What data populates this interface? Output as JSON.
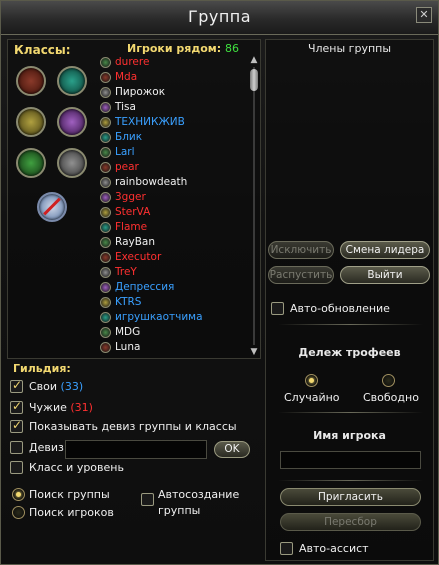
{
  "window": {
    "title": "Группа",
    "close_glyph": "✕"
  },
  "left": {
    "classes_label": "Классы:",
    "players_label": "Игроки рядом:",
    "players_count": "86",
    "class_icons": [
      "class-icon-1",
      "class-icon-2",
      "class-icon-3",
      "class-icon-4",
      "class-icon-5",
      "class-icon-6",
      "class-none-icon"
    ],
    "players": [
      {
        "name": "durere",
        "color": "red"
      },
      {
        "name": "Mda",
        "color": "red"
      },
      {
        "name": "Пирожок",
        "color": "white"
      },
      {
        "name": "Tisa",
        "color": "white"
      },
      {
        "name": "ТЕХНИКЖИВ",
        "color": "blue"
      },
      {
        "name": "Блик",
        "color": "blue"
      },
      {
        "name": "Larl",
        "color": "blue"
      },
      {
        "name": "pear",
        "color": "red"
      },
      {
        "name": "rainbowdeath",
        "color": "white"
      },
      {
        "name": "3gger",
        "color": "red"
      },
      {
        "name": "SterVA",
        "color": "red"
      },
      {
        "name": "Flame",
        "color": "red"
      },
      {
        "name": "RayBan",
        "color": "white"
      },
      {
        "name": "Executor",
        "color": "red"
      },
      {
        "name": "TreY",
        "color": "red"
      },
      {
        "name": "Депрессия",
        "color": "blue"
      },
      {
        "name": "KTRS",
        "color": "blue"
      },
      {
        "name": "игрушкаотчима",
        "color": "blue"
      },
      {
        "name": "MDG",
        "color": "white"
      },
      {
        "name": "Luna",
        "color": "white"
      }
    ]
  },
  "guild": {
    "label": "Гильдия:",
    "own_label": "Свои",
    "own_count": "(33)",
    "foreign_label": "Чужие",
    "foreign_count": "(31)",
    "show_motto_label": "Показывать девиз группы и классы",
    "motto_label": "Девиз",
    "motto_value": "",
    "ok_label": "OK",
    "class_level_label": "Класс и уровень",
    "search_group_label": "Поиск группы",
    "search_players_label": "Поиск игроков",
    "autocreate_label_line1": "Автосоздание",
    "autocreate_label_line2": "группы"
  },
  "right": {
    "members_header": "Члены группы",
    "kick_label": "Исключить",
    "change_leader_label": "Смена лидера",
    "disband_label": "Распустить",
    "leave_label": "Выйти",
    "auto_update_label": "Авто-обновление",
    "loot_title": "Дележ трофеев",
    "loot_random_label": "Случайно",
    "loot_free_label": "Свободно",
    "player_name_title": "Имя игрока",
    "player_name_value": "",
    "invite_label": "Пригласить",
    "reselect_label": "Пересбор",
    "auto_assist_label": "Авто-ассист"
  },
  "colors": {
    "accent": "#f2d870",
    "red": "#ff3030",
    "blue": "#3aa0ff",
    "green": "#3fe03f"
  }
}
